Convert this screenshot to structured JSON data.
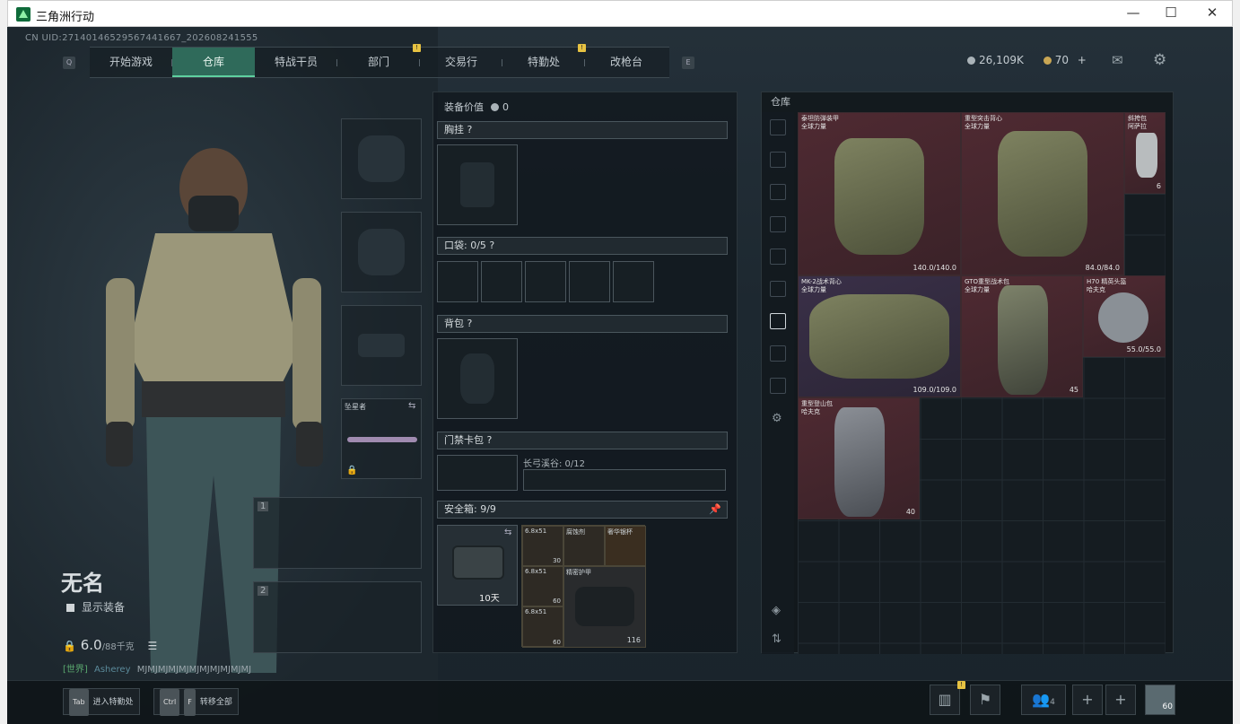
{
  "window": {
    "title": "三角洲行动",
    "minimize": "—",
    "maximize": "☐",
    "close": "✕"
  },
  "uid": "CN UID:27140146529567441667_202608241555",
  "nav": {
    "left_key": "Q",
    "right_key": "E",
    "tabs": [
      {
        "label": "开始游戏"
      },
      {
        "label": "仓库"
      },
      {
        "label": "特战干员"
      },
      {
        "label": "部门",
        "badge": "!"
      },
      {
        "label": "交易行"
      },
      {
        "label": "特勤处",
        "badge": "!"
      },
      {
        "label": "改枪台"
      }
    ]
  },
  "currency": {
    "silver": "26,109K",
    "gold": "70",
    "plus": "+"
  },
  "character": {
    "name": "无名",
    "show_equipment": "显示装备",
    "weight": "6.0",
    "weight_max": "/88千克",
    "chat": "[世界]",
    "chat_user": "Asherey",
    "chat_text": "MJMJMJMJMJMJMJMJMJMJMJ",
    "gun_label": "坠星者",
    "slot1": "1",
    "slot2": "2"
  },
  "equipment": {
    "value_label": "装备价值",
    "value": "0",
    "chest": "胸挂",
    "pocket": "口袋: 0/5",
    "backpack": "背包",
    "keycard": "门禁卡包",
    "keycard_room": "长弓溪谷: 0/12",
    "safebox": "安全箱: 9/9",
    "safebox_days": "10天",
    "safebox_items": [
      {
        "name": "6.8x51",
        "qty": "30"
      },
      {
        "name": "腐蚀剂",
        "qty": ""
      },
      {
        "name": "奢华银杯",
        "qty": ""
      },
      {
        "name": "6.8x51",
        "qty": "60"
      },
      {
        "name": "精密护甲",
        "qty": ""
      },
      {
        "name": "6.8x51",
        "qty": "60"
      },
      {
        "name": "",
        "qty": "116"
      }
    ]
  },
  "warehouse": {
    "title": "仓库",
    "items": [
      {
        "name": "泰坦防弹装甲",
        "sub": "全球力量",
        "value": "140.0/140.0",
        "color": "red"
      },
      {
        "name": "重型突击背心",
        "sub": "全球力量",
        "value": "84.0/84.0",
        "color": "red"
      },
      {
        "name": "斜挎包",
        "sub": "阿萨拉",
        "value": "6",
        "color": "red"
      },
      {
        "name": "MK-2战术背心",
        "sub": "全球力量",
        "value": "109.0/109.0",
        "color": "purple"
      },
      {
        "name": "GTO重型战术包",
        "sub": "全球力量",
        "value": "45",
        "color": "red"
      },
      {
        "name": "H70 精英头盔",
        "sub": "哈夫克",
        "value": "55.0/55.0",
        "color": "red"
      },
      {
        "name": "重型登山包",
        "sub": "哈夫克",
        "value": "40",
        "color": "red"
      }
    ]
  },
  "bottom": {
    "tab_key": "Tab",
    "tab_label": "进入特勤处",
    "ctrl_key": "Ctrl",
    "f_key": "F",
    "transfer_label": "转移全部",
    "squad_count": "4",
    "level": "60"
  }
}
